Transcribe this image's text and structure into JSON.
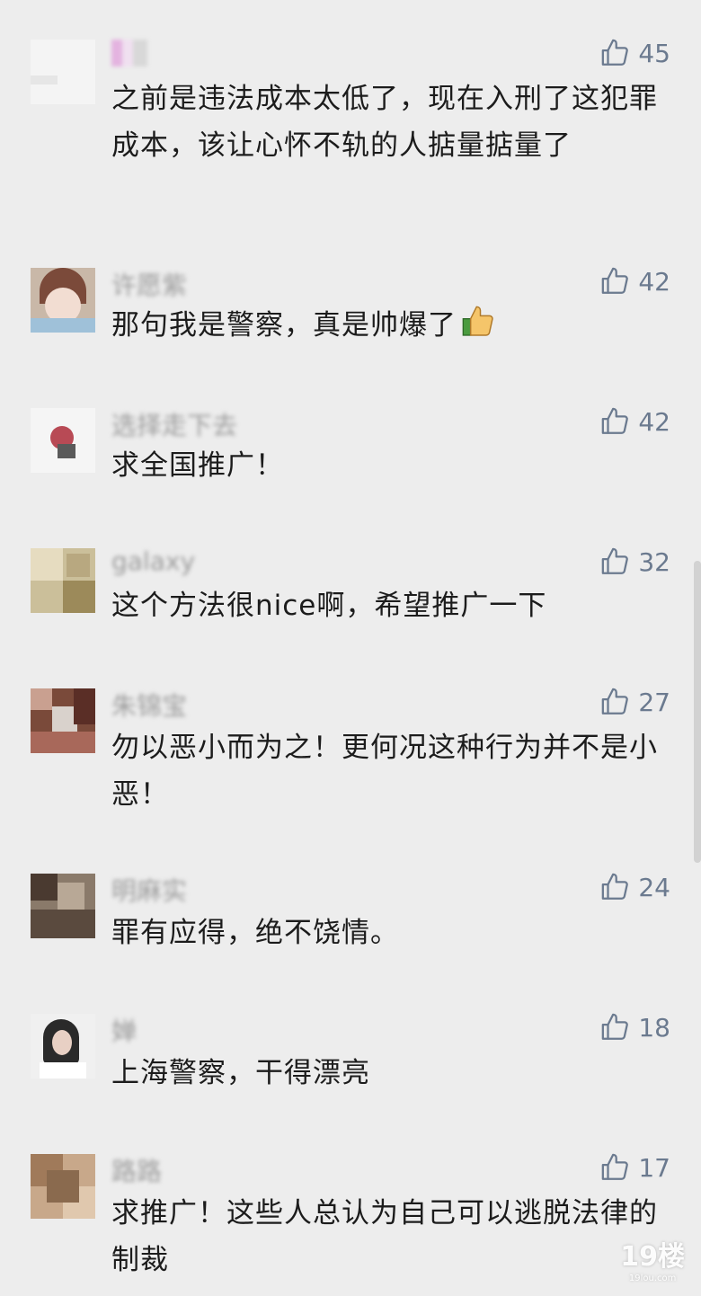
{
  "comments": [
    {
      "username": "",
      "likes": "45",
      "text": "之前是违法成本太低了，现在入刑了这犯罪成本，该让心怀不轨的人掂量掂量了"
    },
    {
      "username": "许愿紫",
      "likes": "42",
      "text": "那句我是警察，真是帅爆了"
    },
    {
      "username": "选择走下去",
      "likes": "42",
      "text": "求全国推广！"
    },
    {
      "username": "galaxy",
      "likes": "32",
      "text": "这个方法很nice啊，希望推广一下"
    },
    {
      "username": "朱锦宝",
      "likes": "27",
      "text": "勿以恶小而为之！更何况这种行为并不是小恶！"
    },
    {
      "username": "明麻实",
      "likes": "24",
      "text": "罪有应得，绝不饶情。"
    },
    {
      "username": "婵",
      "likes": "18",
      "text": "上海警察，干得漂亮"
    },
    {
      "username": "路路",
      "likes": "17",
      "text": "求推广！这些人总认为自己可以逃脱法律的制裁"
    }
  ],
  "watermark": {
    "brand": "19楼",
    "site": "19lou.com"
  },
  "colors": {
    "background": "#ededed",
    "like": "#6b7a8f",
    "text": "#1c1c1c",
    "username": "#9a9a9a"
  },
  "icons": {
    "like": "thumbs-up-outline-icon",
    "emoji": "thumbs-up-emoji-icon"
  }
}
